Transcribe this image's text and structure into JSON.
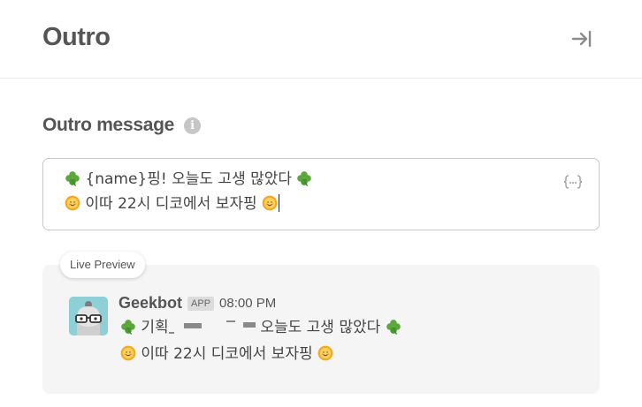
{
  "header": {
    "title": "Outro"
  },
  "outro_section": {
    "label": "Outro message",
    "info_icon": "i",
    "editor": {
      "line1": {
        "leading_emoji": "clover-emoji",
        "text": "{name}핑! 오늘도 고생 많았다",
        "trailing_emoji": "clover-emoji"
      },
      "line2": {
        "leading_emoji": "smiling-sun-emoji",
        "text": "이따 22시 디코에서 보자핑",
        "trailing_emoji": "smiling-sun-emoji"
      },
      "variable_button_icon": "curly-braces-icon"
    }
  },
  "preview": {
    "badge": "Live Preview",
    "bot_name": "Geekbot",
    "app_tag": "APP",
    "time": "08:00 PM",
    "line1": {
      "prefix": "기획",
      "redacted": true,
      "text": "오늘도 고생 많았다"
    },
    "line2": {
      "text": "이따 22시 디코에서 보자핑"
    }
  },
  "colors": {
    "clover": "#5aa83c",
    "sun": "#f5b731",
    "avatar_bg": "#8fcfd6",
    "preview_bg": "#f5f5f5"
  }
}
